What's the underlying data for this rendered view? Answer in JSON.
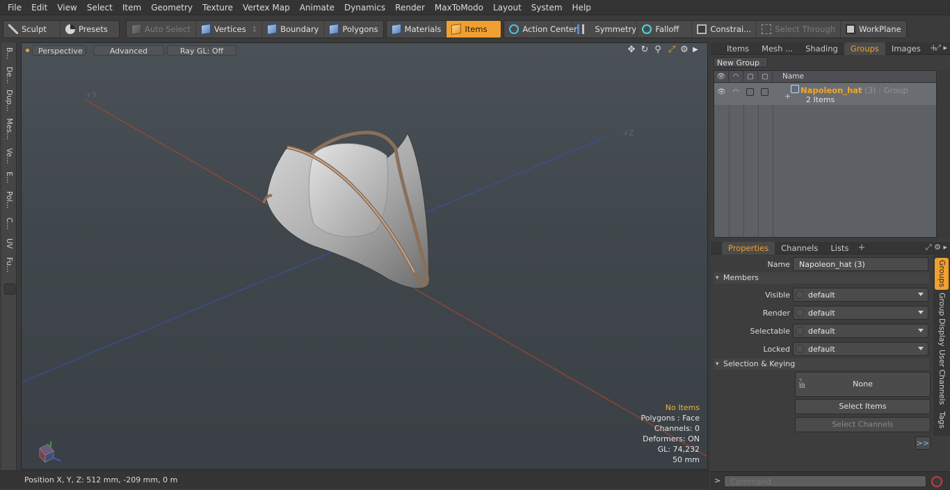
{
  "menu": [
    "File",
    "Edit",
    "View",
    "Select",
    "Item",
    "Geometry",
    "Texture",
    "Vertex Map",
    "Animate",
    "Dynamics",
    "Render",
    "MaxToModo",
    "Layout",
    "System",
    "Help"
  ],
  "toolbar": {
    "sculpt": "Sculpt",
    "presets": "Presets",
    "auto_select": "Auto Select",
    "vertices": "Vertices",
    "vertices_count": "1",
    "boundary": "Boundary",
    "polygons": "Polygons",
    "materials": "Materials",
    "items": "Items",
    "action_center": "Action Center",
    "symmetry": "Symmetry",
    "falloff": "Falloff",
    "constraints": "Constrai...",
    "select_through": "Select Through",
    "workplane": "WorkPlane"
  },
  "left_tabs": [
    "B...",
    "De...",
    "Dup...",
    "Mes...",
    "Ve...",
    "E...",
    "Pol...",
    "C...",
    "UV",
    "Fu..."
  ],
  "viewport": {
    "view_mode": "Perspective",
    "shading": "Advanced",
    "raygl": "Ray GL: Off",
    "axis_x_label": "+X",
    "axis_z_label": "+Z",
    "overlay": {
      "no_items": "No Items",
      "polygons": "Polygons : Face",
      "channels": "Channels: 0",
      "deformers": "Deformers: ON",
      "gl": "GL: 74,232",
      "scale": "50 mm"
    }
  },
  "status": {
    "position": "Position X, Y, Z:   512 mm, -209 mm, 0 m"
  },
  "top_panel": {
    "tabs": [
      "Items",
      "Mesh ...",
      "Shading",
      "Groups",
      "Images"
    ],
    "active_tab": "Groups",
    "new_group": "New Group",
    "column_name": "Name",
    "group": {
      "name": "Napoleon_hat",
      "count": " (3)",
      "type": " : Group",
      "sub": "2 Items"
    }
  },
  "props": {
    "tabs": [
      "Properties",
      "Channels",
      "Lists"
    ],
    "name_label": "Name",
    "name_value": "Napoleon_hat (3)",
    "members": "Members",
    "fields": [
      {
        "label": "Visible",
        "value": "default"
      },
      {
        "label": "Render",
        "value": "default"
      },
      {
        "label": "Selectable",
        "value": "default"
      },
      {
        "label": "Locked",
        "value": "default"
      }
    ],
    "selection_keying": "Selection & Keying",
    "none": "None",
    "select_items": "Select Items",
    "select_channels": "Select Channels",
    "more": ">>",
    "side_tabs": [
      "Groups",
      "Group Display",
      "User Channels",
      "Tags"
    ]
  },
  "command": {
    "placeholder": "Command",
    "prompt": ">"
  }
}
